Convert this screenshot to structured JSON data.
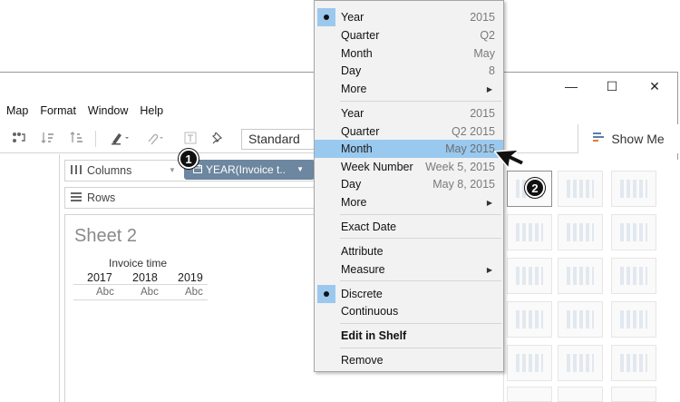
{
  "window_controls": {
    "minimize": "—",
    "maximize": "☐",
    "close": "✕"
  },
  "menubar": [
    "Map",
    "Format",
    "Window",
    "Help"
  ],
  "toolbar": {
    "fit_value": "Standard",
    "show_me_label": "Show Me"
  },
  "shelves": {
    "columns_label": "Columns",
    "rows_label": "Rows",
    "pill_label": "YEAR(Invoice t.."
  },
  "sheet": {
    "title": "Sheet 2",
    "field_title": "Invoice time",
    "years": [
      "2017",
      "2018",
      "2019"
    ],
    "cell_text": "Abc"
  },
  "context_menu": {
    "group1": [
      {
        "label": "Year",
        "value": "2015",
        "checked": true
      },
      {
        "label": "Quarter",
        "value": "Q2"
      },
      {
        "label": "Month",
        "value": "May"
      },
      {
        "label": "Day",
        "value": "8"
      },
      {
        "label": "More",
        "submenu": true
      }
    ],
    "group2": [
      {
        "label": "Year",
        "value": "2015"
      },
      {
        "label": "Quarter",
        "value": "Q2 2015"
      },
      {
        "label": "Month",
        "value": "May 2015",
        "highlighted": true
      },
      {
        "label": "Week Number",
        "value": "Week 5, 2015"
      },
      {
        "label": "Day",
        "value": "May 8, 2015"
      },
      {
        "label": "More",
        "submenu": true
      }
    ],
    "exact_date": "Exact Date",
    "attribute": "Attribute",
    "measure": "Measure",
    "discrete": "Discrete",
    "continuous": "Continuous",
    "edit_in_shelf": "Edit in Shelf",
    "remove": "Remove"
  },
  "callouts": {
    "step1": "1",
    "step2": "2"
  },
  "colors": {
    "pill": "#6c879f",
    "menu_highlight": "#99c9ef",
    "menu_background": "#f2f2f2",
    "checked_background": "#9cc8ee"
  }
}
